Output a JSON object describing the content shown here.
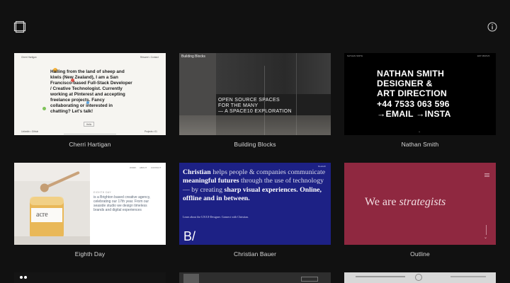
{
  "info_icon": "info-icon",
  "logo_icon": "stacked-squares-icon",
  "gallery": {
    "row1": [
      {
        "caption": "Cherri Hartigan",
        "mini_tl": "Cherri Hartigan",
        "mini_tr": "Résumé • Contact",
        "body": "Hailing from the land of sheep and kiwis (New Zealand), I am a San Francisco-based Full-Stack Developer / Creative Technologist. Currently working at Pinterest and accepting freelance projects. Fancy collaborating or interested in chatting? Let's talk!",
        "mini_bl": "Linkedin • Github",
        "mini_br": "Projects • 01",
        "button": "Hello"
      },
      {
        "caption": "Building Blocks",
        "tiny_tl": "Building Blocks",
        "text_line1": "OPEN SOURCE SPACES",
        "text_line2": "FOR THE MANY",
        "text_line3": "— A SPACE10 EXPLORATION"
      },
      {
        "caption": "Nathan Smith",
        "line1": "NATHAN SMITH",
        "line2": "DESIGNER &",
        "line3": "ART DIRECTION",
        "line4": "+44 7533 063 596",
        "line5": "→EMAIL →INSTA",
        "mini_tl": "NATHAN SMITH",
        "mini_tr": "EST MMXVII"
      }
    ],
    "row2": [
      {
        "caption": "Eighth Day",
        "label": "EIGHTH DAY",
        "desc": "is a Brighton based creative agency, celebrating our 17th year. From our seaside studio we design timeless brands and digital experiences",
        "nav1": "WORK",
        "nav2": "ABOUT",
        "nav3": "CONTACT",
        "jar_label": "acre"
      },
      {
        "caption": "Christian Bauer",
        "name": "Christian",
        "t1": " helps people & companies communicate ",
        "t2": "meaningful futures",
        "t3": " through the use of technology — by creating ",
        "t4": "sharp visual experiences.",
        "t5": " Online, offline and in between.",
        "sub": "Learn about the UX/UI-Designer. Connect with Christian.",
        "logo": "B/",
        "tag": "Deutsch"
      },
      {
        "caption": "Outline",
        "text_a": "We are ",
        "text_b": "strategists"
      }
    ]
  }
}
